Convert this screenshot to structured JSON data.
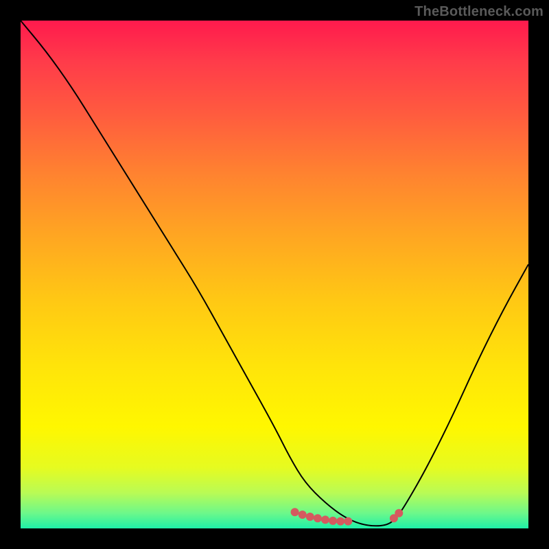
{
  "watermark": "TheBottleneck.com",
  "chart_data": {
    "type": "line",
    "title": "",
    "xlabel": "",
    "ylabel": "",
    "xlim": [
      0,
      100
    ],
    "ylim": [
      0,
      100
    ],
    "series": [
      {
        "name": "curve",
        "x": [
          0,
          5,
          10,
          15,
          20,
          25,
          30,
          35,
          40,
          45,
          50,
          53,
          56,
          60,
          64,
          68,
          72,
          74,
          76,
          80,
          85,
          90,
          95,
          100
        ],
        "values": [
          100,
          94,
          87,
          79,
          71,
          63,
          55,
          47,
          38,
          29,
          20,
          14,
          9,
          5,
          2,
          0.5,
          0.5,
          2,
          5,
          12,
          22,
          33,
          43,
          52
        ]
      },
      {
        "name": "markers-left",
        "x": [
          54,
          55.5,
          57,
          58.5,
          60,
          61.5,
          63,
          64.5
        ],
        "values": [
          3.2,
          2.7,
          2.3,
          2.0,
          1.7,
          1.5,
          1.4,
          1.4
        ]
      },
      {
        "name": "markers-right",
        "x": [
          73.5,
          74.5
        ],
        "values": [
          2.0,
          3.0
        ]
      }
    ],
    "marker_color": "#d55a5f",
    "curve_color": "#000000"
  }
}
